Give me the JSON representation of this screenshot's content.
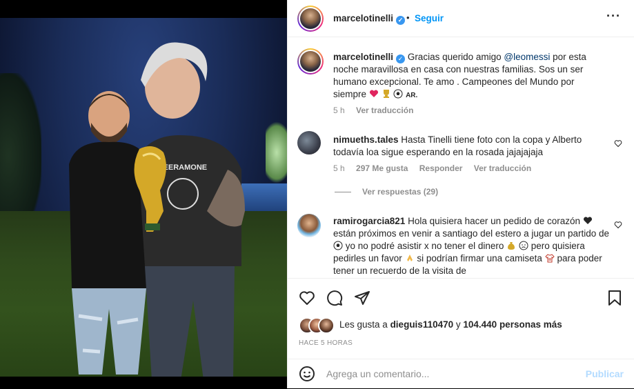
{
  "post": {
    "author": "marcelotinelli",
    "follow_label": "Seguir",
    "dot": "•",
    "caption_user": "marcelotinelli",
    "caption_pre": "Gracias querido amigo ",
    "caption_mention": "@leomessi",
    "caption_post": " por esta noche maravillosa en casa con nuestras familias. Sos un ser humano excepcional. Te amo . Campeones del Mundo por siempre",
    "caption_flag": "AR.",
    "caption_time": "5 h",
    "caption_translate": "Ver traducción"
  },
  "comments": [
    {
      "user": "nimueths.tales",
      "text": "Hasta Tinelli tiene foto con la copa y Alberto todavía loa sigue esperando en la rosada jajajajaja",
      "time": "5 h",
      "likes": "297 Me gusta",
      "reply": "Responder",
      "translate": "Ver traducción",
      "view_replies": "Ver respuestas (29)"
    },
    {
      "user": "ramirogarcia821",
      "text_1": "Hola quisiera hacer un pedido de corazón",
      "text_2": "están próximos en venir a santiago del estero a jugar un partido de",
      "text_3": "yo no podré asistir x no tener el dinero",
      "text_4": "pero quisiera pedirles un favor",
      "text_5": "si podrían firmar una camiseta",
      "text_6": "para poder tener un recuerdo de la visita de"
    }
  ],
  "likes": {
    "prefix": "Les gusta a ",
    "user": "dieguis110470",
    "middle": " y ",
    "count": "104.440 personas más"
  },
  "timestamp": "HACE 5 HORAS",
  "composer": {
    "placeholder": "Agrega un comentario...",
    "publish": "Publicar"
  },
  "icons": [
    "heart-icon",
    "comment-icon",
    "share-icon",
    "bookmark-icon",
    "emoji-icon",
    "more-icon",
    "verified-icon"
  ],
  "colors": {
    "accent": "#0095f6",
    "publish_disabled": "#b3dbff",
    "muted": "#8e8e8e"
  }
}
